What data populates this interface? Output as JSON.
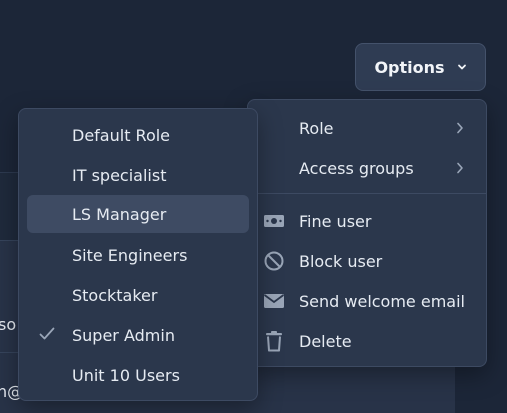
{
  "background": {
    "clipped_text_1": "so",
    "clipped_text_2": "n@"
  },
  "options_button": {
    "label": "Options",
    "icon": "chevron-down-icon"
  },
  "options_menu": {
    "items": [
      {
        "label": "Role",
        "icon": "chevron-right-icon"
      },
      {
        "label": "Access groups",
        "icon": "chevron-right-icon"
      },
      {
        "label": "Fine user",
        "icon": "money-icon"
      },
      {
        "label": "Block user",
        "icon": "block-icon"
      },
      {
        "label": "Send welcome email",
        "icon": "envelope-icon"
      },
      {
        "label": "Delete",
        "icon": "trash-icon"
      }
    ]
  },
  "role_menu": {
    "selected": "Super Admin",
    "highlighted": "LS Manager",
    "items": [
      {
        "label": "Default Role"
      },
      {
        "label": "IT specialist"
      },
      {
        "label": "LS Manager"
      },
      {
        "label": "Site Engineers"
      },
      {
        "label": "Stocktaker"
      },
      {
        "label": "Super Admin",
        "icon": "check-icon"
      },
      {
        "label": "Unit 10 Users"
      }
    ]
  },
  "colors": {
    "background": "#1c2638",
    "menu": "#2b374c",
    "highlight": "#3e4b63",
    "text": "#e6ebf2"
  }
}
